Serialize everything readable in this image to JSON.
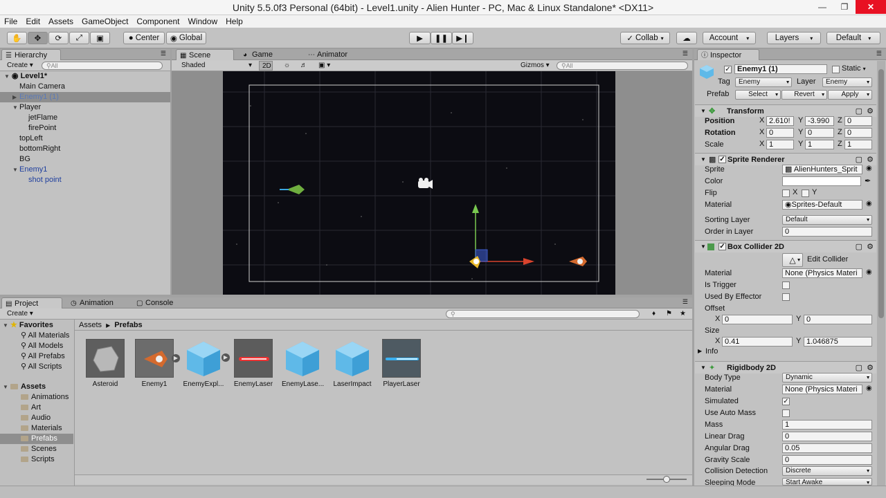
{
  "window": {
    "title": "Unity 5.5.0f3 Personal (64bit) - Level1.unity - Alien Hunter - PC, Mac & Linux Standalone* <DX11>"
  },
  "menu": [
    "File",
    "Edit",
    "Assets",
    "GameObject",
    "Component",
    "Window",
    "Help"
  ],
  "toolbar": {
    "center": "Center",
    "global": "Global",
    "collab": "Collab",
    "account": "Account",
    "layers": "Layers",
    "layout": "Default"
  },
  "hierarchy": {
    "tab": "Hierarchy",
    "create": "Create",
    "search": "All",
    "scene": "Level1*",
    "items": [
      "Main Camera",
      "Enemy1 (1)",
      "Player",
      "jetFlame",
      "firePoint",
      "topLeft",
      "bottomRight",
      "BG",
      "Enemy1",
      "shot point"
    ]
  },
  "scene_tabs": {
    "scene": "Scene",
    "game": "Game",
    "animator": "Animator",
    "shaded": "Shaded",
    "mode2d": "2D",
    "gizmos": "Gizmos",
    "search": "All"
  },
  "project": {
    "tabs": [
      "Project",
      "Animation",
      "Console"
    ],
    "create": "Create",
    "favorites": "Favorites",
    "fav_items": [
      "All Materials",
      "All Models",
      "All Prefabs",
      "All Scripts"
    ],
    "assets_root": "Assets",
    "folders": [
      "Animations",
      "Art",
      "Audio",
      "Materials",
      "Prefabs",
      "Scenes",
      "Scripts"
    ],
    "breadcrumb_root": "Assets",
    "breadcrumb_current": "Prefabs",
    "assets": [
      "Asteroid",
      "Enemy1",
      "EnemyExpl...",
      "EnemyLaser",
      "EnemyLase...",
      "LaserImpact",
      "PlayerLaser"
    ]
  },
  "inspector": {
    "tab": "Inspector",
    "name": "Enemy1 (1)",
    "static": "Static",
    "tag_label": "Tag",
    "tag": "Enemy",
    "layer_label": "Layer",
    "layer": "Enemy",
    "prefab_label": "Prefab",
    "select": "Select",
    "revert": "Revert",
    "apply": "Apply",
    "transform": {
      "title": "Transform",
      "position": "Position",
      "rotation": "Rotation",
      "scale": "Scale",
      "px": "2.610!",
      "py": "-3.990",
      "pz": "0",
      "rx": "0",
      "ry": "0",
      "rz": "0",
      "sx": "1",
      "sy": "1",
      "sz": "1"
    },
    "sprite": {
      "title": "Sprite Renderer",
      "sprite_label": "Sprite",
      "sprite": "AlienHunters_Sprit",
      "color": "Color",
      "flip": "Flip",
      "x": "X",
      "y": "Y",
      "material_label": "Material",
      "material": "Sprites-Default",
      "sorting_label": "Sorting Layer",
      "sorting": "Default",
      "order_label": "Order in Layer",
      "order": "0"
    },
    "collider": {
      "title": "Box Collider 2D",
      "edit": "Edit Collider",
      "material_label": "Material",
      "material": "None (Physics Materi",
      "trigger": "Is Trigger",
      "effector": "Used By Effector",
      "offset": "Offset",
      "ox": "0",
      "oy": "0",
      "size": "Size",
      "sx": "0.41",
      "sy": "1.046875",
      "info": "Info",
      "x": "X",
      "y": "Y"
    },
    "rigidbody": {
      "title": "Rigidbody 2D",
      "body_label": "Body Type",
      "body": "Dynamic",
      "material_label": "Material",
      "material": "None (Physics Materi",
      "simulated": "Simulated",
      "auto_mass": "Use Auto Mass",
      "mass_label": "Mass",
      "mass": "1",
      "linear_label": "Linear Drag",
      "linear": "0",
      "angular_label": "Angular Drag",
      "angular": "0.05",
      "gravity_label": "Gravity Scale",
      "gravity": "0",
      "collision_label": "Collision Detection",
      "collision": "Discrete",
      "sleeping_label": "Sleeping Mode",
      "sleeping": "Start Awake"
    }
  },
  "colors": {
    "accent": "#3d6ebf",
    "selected": "#8e8e8e",
    "scene_bg": "#0c0c12"
  }
}
